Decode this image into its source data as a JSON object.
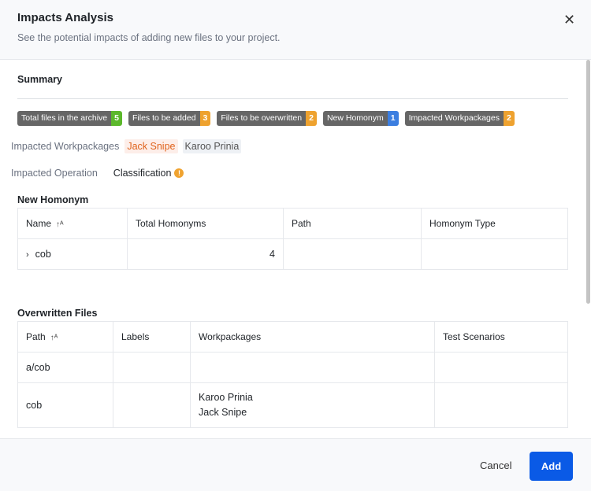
{
  "header": {
    "title": "Impacts Analysis",
    "subtitle": "See the potential impacts of adding new files to your project.",
    "close_icon": "close-icon"
  },
  "summary": {
    "title": "Summary",
    "badges": [
      {
        "label": "Total files in the archive",
        "count": "5",
        "color": "#5cb82c"
      },
      {
        "label": "Files to be added",
        "count": "3",
        "color": "#eea22f"
      },
      {
        "label": "Files to be overwritten",
        "count": "2",
        "color": "#eea22f"
      },
      {
        "label": "New Homonym",
        "count": "1",
        "color": "#3b7ee0"
      },
      {
        "label": "Impacted Workpackages",
        "count": "2",
        "color": "#eea22f"
      }
    ],
    "impacted_workpackages_label": "Impacted Workpackages",
    "workpackages": [
      "Jack Snipe",
      "Karoo Prinia"
    ],
    "impacted_operation_label": "Impacted Operation",
    "operation": "Classification"
  },
  "homonym": {
    "title": "New Homonym",
    "columns": [
      "Name",
      "Total Homonyms",
      "Path",
      "Homonym Type"
    ],
    "rows": [
      {
        "name": "cob",
        "total": "4",
        "path": "",
        "type": ""
      }
    ]
  },
  "overwritten": {
    "title": "Overwritten Files",
    "columns": [
      "Path",
      "Labels",
      "Workpackages",
      "Test Scenarios"
    ],
    "rows": [
      {
        "path": "a/cob",
        "labels": "",
        "wp1": "",
        "wp2": "",
        "tests": ""
      },
      {
        "path": "cob",
        "labels": "",
        "wp1": "Karoo Prinia",
        "wp2": "Jack Snipe",
        "tests": ""
      }
    ]
  },
  "footer": {
    "cancel": "Cancel",
    "add": "Add"
  }
}
